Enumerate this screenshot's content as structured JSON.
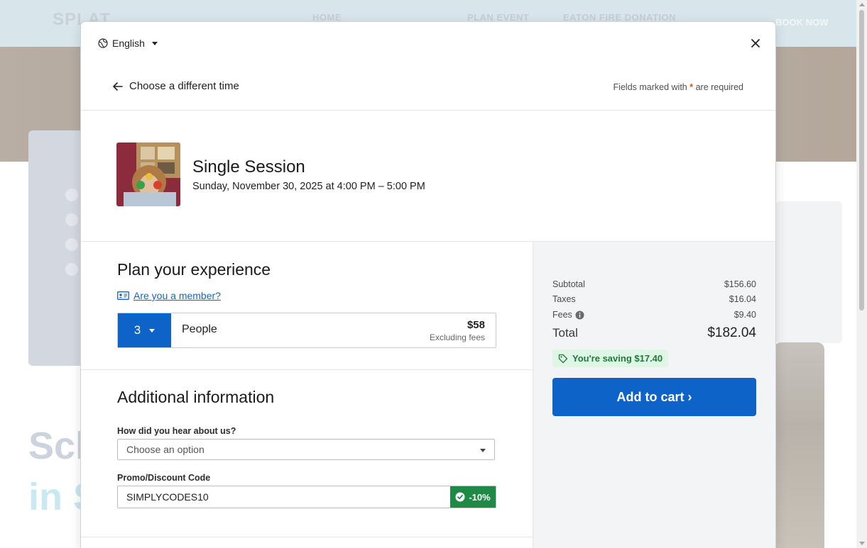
{
  "background": {
    "logo": "SPLAT",
    "nav": [
      "HOME",
      "PLAN EVENT",
      "EATON FIRE DONATION"
    ],
    "nav_cta": "BOOK NOW",
    "headline_1": "Sch",
    "headline_2": "in S"
  },
  "modal": {
    "language": "English",
    "back_label": "Choose a different time",
    "required_note_prefix": "Fields marked with",
    "required_note_star": "*",
    "required_note_suffix": "are required",
    "event": {
      "title": "Single Session",
      "datetime": "Sunday, November 30, 2025 at 4:00 PM – 5:00 PM"
    },
    "plan": {
      "title": "Plan your experience",
      "member_link": "Are you a member?",
      "ticket": {
        "quantity": "3",
        "label": "People",
        "price": "$58",
        "price_note": "Excluding fees"
      }
    },
    "additional": {
      "title": "Additional information",
      "hear_label": "How did you hear about us?",
      "hear_placeholder": "Choose an option",
      "promo_label": "Promo/Discount Code",
      "promo_value": "SIMPLYCODES10",
      "promo_discount": "-10%"
    },
    "summary": {
      "subtotal_label": "Subtotal",
      "subtotal": "$156.60",
      "taxes_label": "Taxes",
      "taxes": "$16.04",
      "fees_label": "Fees",
      "fees": "$9.40",
      "total_label": "Total",
      "total": "$182.04",
      "saving": "You're saving $17.40",
      "add_to_cart": "Add to cart ›"
    }
  },
  "colors": {
    "primary": "#0e63c8",
    "success": "#1e8a45",
    "required_star": "#d9531e"
  }
}
